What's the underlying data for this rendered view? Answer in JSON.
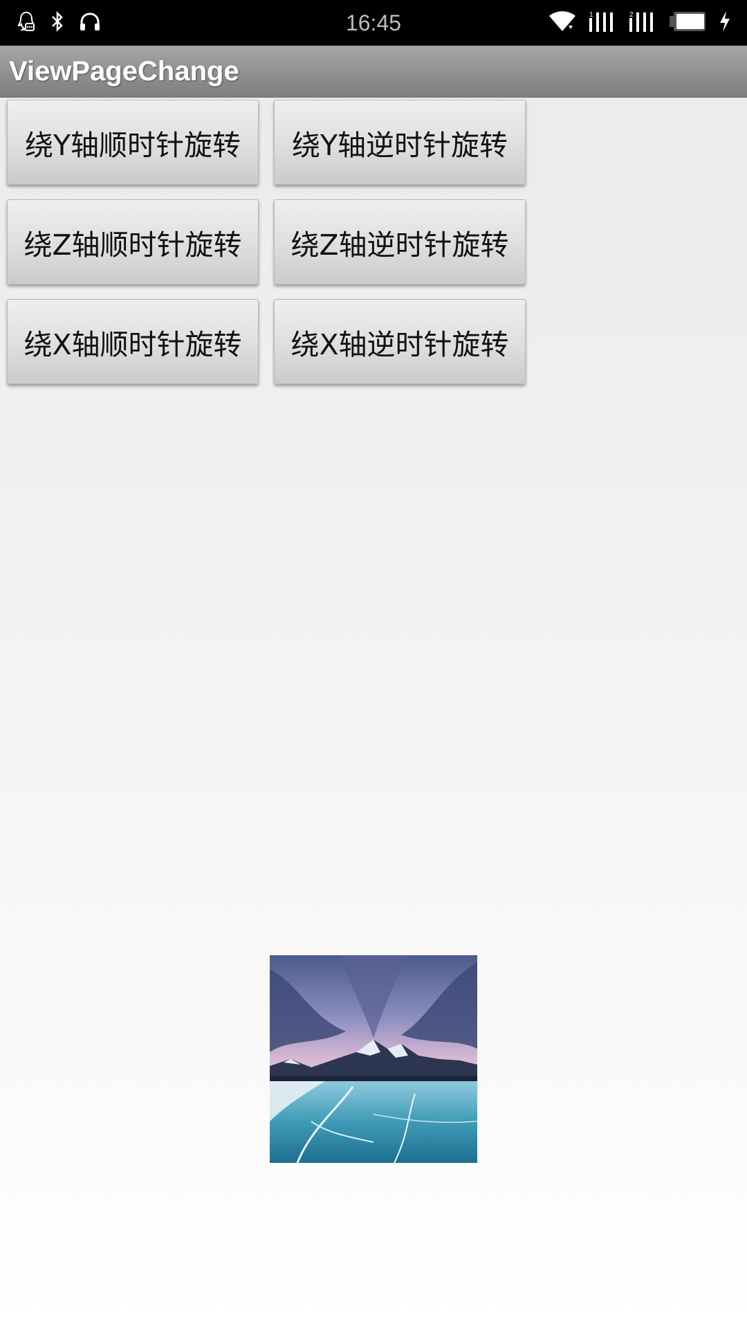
{
  "status_bar": {
    "time": "16:45",
    "left_icons": [
      "qq-notification-icon",
      "bluetooth-icon",
      "headphones-icon"
    ],
    "right_icons": [
      "wifi-icon",
      "signal-sim1-icon",
      "signal-sim2-icon",
      "battery-icon",
      "charging-icon"
    ],
    "background": "#000000"
  },
  "app_bar": {
    "title": "ViewPageChange"
  },
  "buttons": {
    "y_clockwise": "绕Y轴顺时针旋转",
    "y_counterclockwise": "绕Y轴逆时针旋转",
    "z_clockwise": "绕Z轴顺时针旋转",
    "z_counterclockwise": "绕Z轴逆时针旋转",
    "x_clockwise": "绕X轴顺时针旋转",
    "x_counterclockwise": "绕X轴逆时针旋转"
  },
  "image": {
    "subject": "frozen-lake-mountain-landscape"
  }
}
